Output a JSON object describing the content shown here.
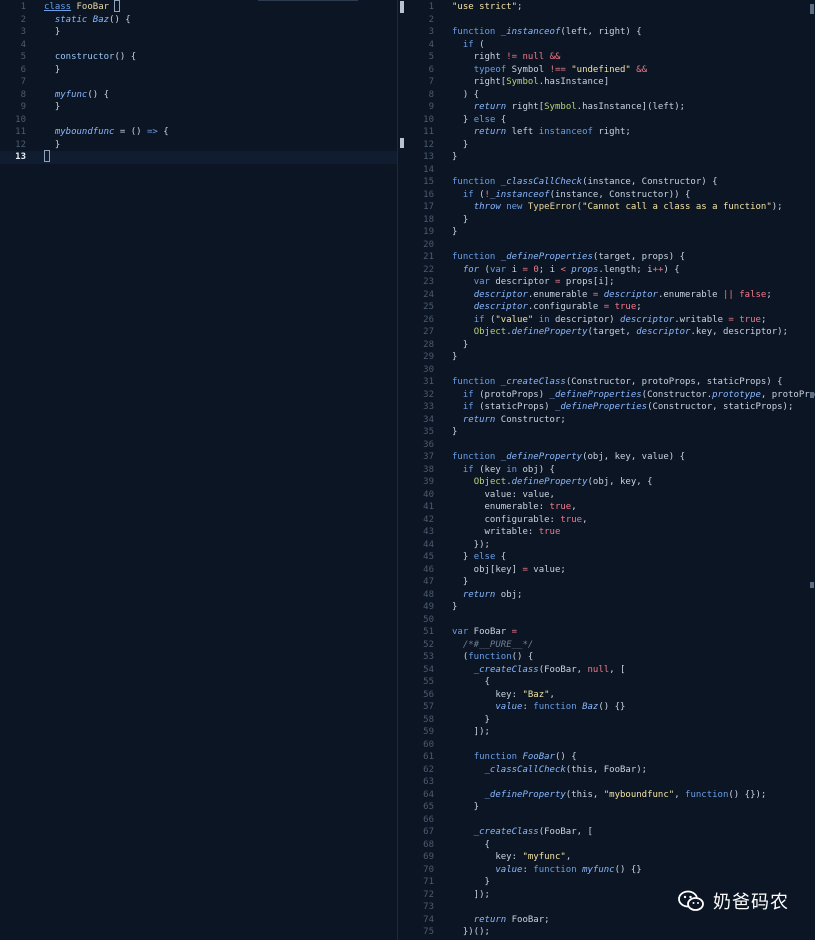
{
  "left_editor": {
    "lines": [
      {
        "n": "1",
        "code": "<span class=\"kw ul\">class</span> <span class=\"cls\">FooBar</span> <span class=\"caret\"></span>"
      },
      {
        "n": "2",
        "code": "  <span class=\"it\">static</span> <span class=\"fn\">Baz</span>() {"
      },
      {
        "n": "3",
        "code": "  }"
      },
      {
        "n": "4",
        "code": ""
      },
      {
        "n": "5",
        "code": "  <span class=\"sf\">constructor</span>() {"
      },
      {
        "n": "6",
        "code": "  }"
      },
      {
        "n": "7",
        "code": ""
      },
      {
        "n": "8",
        "code": "  <span class=\"fn\">myfunc</span>() {"
      },
      {
        "n": "9",
        "code": "  }"
      },
      {
        "n": "10",
        "code": ""
      },
      {
        "n": "11",
        "code": "  <span class=\"fn\">myboundfunc</span> = () <span class=\"kw\">=&gt;</span> {"
      },
      {
        "n": "12",
        "code": "  }"
      },
      {
        "n": "13",
        "code": "<span class=\"caret\"></span>"
      }
    ],
    "current_line": "13"
  },
  "right_editor": {
    "lines": [
      {
        "n": "1",
        "code": "<span class=\"str\">\"use strict\"</span>;"
      },
      {
        "n": "2",
        "code": ""
      },
      {
        "n": "3",
        "code": "<span class=\"kw\">function</span> <span class=\"fn\">_instanceof</span>(left, right) {"
      },
      {
        "n": "4",
        "code": "  <span class=\"kw\">if</span> ("
      },
      {
        "n": "5",
        "code": "    right <span class=\"op\">!=</span> <span class=\"lit\">null</span> <span class=\"op\">&amp;&amp;</span>"
      },
      {
        "n": "6",
        "code": "    <span class=\"kw\">typeof</span> Symbol <span class=\"op\">!==</span> <span class=\"str\">\"undefined\"</span> <span class=\"op\">&amp;&amp;</span>"
      },
      {
        "n": "7",
        "code": "    right[<span class=\"obj\">Symbol</span>.hasInstance]"
      },
      {
        "n": "8",
        "code": "  ) {"
      },
      {
        "n": "9",
        "code": "    <span class=\"it\">return</span> right[<span class=\"obj\">Symbol</span>.hasInstance](left);"
      },
      {
        "n": "10",
        "code": "  } <span class=\"kw\">else</span> {"
      },
      {
        "n": "11",
        "code": "    <span class=\"it\">return</span> left <span class=\"kw\">instanceof</span> right;"
      },
      {
        "n": "12",
        "code": "  }"
      },
      {
        "n": "13",
        "code": "}"
      },
      {
        "n": "14",
        "code": ""
      },
      {
        "n": "15",
        "code": "<span class=\"kw\">function</span> <span class=\"fn\">_classCallCheck</span>(instance, Constructor) {"
      },
      {
        "n": "16",
        "code": "  <span class=\"kw\">if</span> (<span class=\"op\">!</span><span class=\"fn\">_instanceof</span>(instance, Constructor)) {"
      },
      {
        "n": "17",
        "code": "    <span class=\"it\">throw</span> <span class=\"kw\">new</span> <span class=\"cls\">TypeError</span>(<span class=\"str\">\"Cannot call a class as a function\"</span>);"
      },
      {
        "n": "18",
        "code": "  }"
      },
      {
        "n": "19",
        "code": "}"
      },
      {
        "n": "20",
        "code": ""
      },
      {
        "n": "21",
        "code": "<span class=\"kw\">function</span> <span class=\"fn\">_defineProperties</span>(target, props) {"
      },
      {
        "n": "22",
        "code": "  <span class=\"it\">for</span> (<span class=\"kw\">var</span> i <span class=\"op\">=</span> <span class=\"lit\">0</span>; i <span class=\"op\">&lt;</span> <span class=\"it\">props</span>.length; i<span class=\"op\">++</span>) {"
      },
      {
        "n": "23",
        "code": "    <span class=\"kw\">var</span> descriptor <span class=\"op\">=</span> props[i];"
      },
      {
        "n": "24",
        "code": "    <span class=\"it\">descriptor</span>.enumerable <span class=\"op\">=</span> <span class=\"it\">descriptor</span>.enumerable <span class=\"op\">||</span> <span class=\"lit\">false</span>;"
      },
      {
        "n": "25",
        "code": "    <span class=\"it\">descriptor</span>.configurable <span class=\"op\">=</span> <span class=\"lit\">true</span>;"
      },
      {
        "n": "26",
        "code": "    <span class=\"kw\">if</span> (<span class=\"str\">\"value\"</span> <span class=\"kw\">in</span> descriptor) <span class=\"it\">descriptor</span>.writable <span class=\"op\">=</span> <span class=\"lit\">true</span>;"
      },
      {
        "n": "27",
        "code": "    <span class=\"obj\">Object</span>.<span class=\"fn\">defineProperty</span>(target, <span class=\"it\">descriptor</span>.key, descriptor);"
      },
      {
        "n": "28",
        "code": "  }"
      },
      {
        "n": "29",
        "code": "}"
      },
      {
        "n": "30",
        "code": ""
      },
      {
        "n": "31",
        "code": "<span class=\"kw\">function</span> <span class=\"fn\">_createClass</span>(Constructor, protoProps, staticProps) {"
      },
      {
        "n": "32",
        "code": "  <span class=\"kw\">if</span> (protoProps) <span class=\"fn\">_defineProperties</span>(Constructor.<span class=\"it\">prototype</span>, protoProps);"
      },
      {
        "n": "33",
        "code": "  <span class=\"kw\">if</span> (staticProps) <span class=\"fn\">_defineProperties</span>(Constructor, staticProps);"
      },
      {
        "n": "34",
        "code": "  <span class=\"it\">return</span> Constructor;"
      },
      {
        "n": "35",
        "code": "}"
      },
      {
        "n": "36",
        "code": ""
      },
      {
        "n": "37",
        "code": "<span class=\"kw\">function</span> <span class=\"fn\">_defineProperty</span>(obj, key, value) {"
      },
      {
        "n": "38",
        "code": "  <span class=\"kw\">if</span> (key <span class=\"kw\">in</span> obj) {"
      },
      {
        "n": "39",
        "code": "    <span class=\"obj\">Object</span>.<span class=\"fn\">defineProperty</span>(obj, key, {"
      },
      {
        "n": "40",
        "code": "      value: value,"
      },
      {
        "n": "41",
        "code": "      enumerable: <span class=\"lit\">true</span>,"
      },
      {
        "n": "42",
        "code": "      configurable: <span class=\"lit\">true</span>,"
      },
      {
        "n": "43",
        "code": "      writable: <span class=\"lit\">true</span>"
      },
      {
        "n": "44",
        "code": "    });"
      },
      {
        "n": "45",
        "code": "  } <span class=\"kw\">else</span> {"
      },
      {
        "n": "46",
        "code": "    obj[key] <span class=\"op\">=</span> value;"
      },
      {
        "n": "47",
        "code": "  }"
      },
      {
        "n": "48",
        "code": "  <span class=\"it\">return</span> obj;"
      },
      {
        "n": "49",
        "code": "}"
      },
      {
        "n": "50",
        "code": ""
      },
      {
        "n": "51",
        "code": "<span class=\"kw\">var</span> FooBar <span class=\"op\">=</span>"
      },
      {
        "n": "52",
        "code": "  <span class=\"cmt\">/*#__PURE__*/</span>"
      },
      {
        "n": "53",
        "code": "  (<span class=\"kw\">function</span>() {"
      },
      {
        "n": "54",
        "code": "    <span class=\"fn\">_createClass</span>(FooBar, <span class=\"lit\">null</span>, ["
      },
      {
        "n": "55",
        "code": "      {"
      },
      {
        "n": "56",
        "code": "        key: <span class=\"str\">\"Baz\"</span>,"
      },
      {
        "n": "57",
        "code": "        <span class=\"it\">value</span>: <span class=\"kw\">function</span> <span class=\"fn\">Baz</span>() {}"
      },
      {
        "n": "58",
        "code": "      }"
      },
      {
        "n": "59",
        "code": "    ]);"
      },
      {
        "n": "60",
        "code": ""
      },
      {
        "n": "61",
        "code": "    <span class=\"kw\">function</span> <span class=\"fn\">FooBar</span>() {"
      },
      {
        "n": "62",
        "code": "      <span class=\"fn\">_classCallCheck</span>(this, FooBar);"
      },
      {
        "n": "63",
        "code": ""
      },
      {
        "n": "64",
        "code": "      <span class=\"fn\">_defineProperty</span>(this, <span class=\"str\">\"myboundfunc\"</span>, <span class=\"kw\">function</span>() {});"
      },
      {
        "n": "65",
        "code": "    }"
      },
      {
        "n": "66",
        "code": ""
      },
      {
        "n": "67",
        "code": "    <span class=\"fn\">_createClass</span>(FooBar, ["
      },
      {
        "n": "68",
        "code": "      {"
      },
      {
        "n": "69",
        "code": "        key: <span class=\"str\">\"myfunc\"</span>,"
      },
      {
        "n": "70",
        "code": "        <span class=\"it\">value</span>: <span class=\"kw\">function</span> <span class=\"fn\">myfunc</span>() {}"
      },
      {
        "n": "71",
        "code": "      }"
      },
      {
        "n": "72",
        "code": "    ]);"
      },
      {
        "n": "73",
        "code": ""
      },
      {
        "n": "74",
        "code": "    <span class=\"it\">return</span> FooBar;"
      },
      {
        "n": "75",
        "code": "  })();"
      }
    ]
  },
  "watermark": {
    "text": "奶爸码农",
    "icon": "wechat-icon"
  },
  "colors": {
    "background": "#0b1524",
    "keyword": "#6a9fe8",
    "string": "#f2e3a4",
    "literal": "#f07a8a",
    "function": "#8ab8ff"
  }
}
